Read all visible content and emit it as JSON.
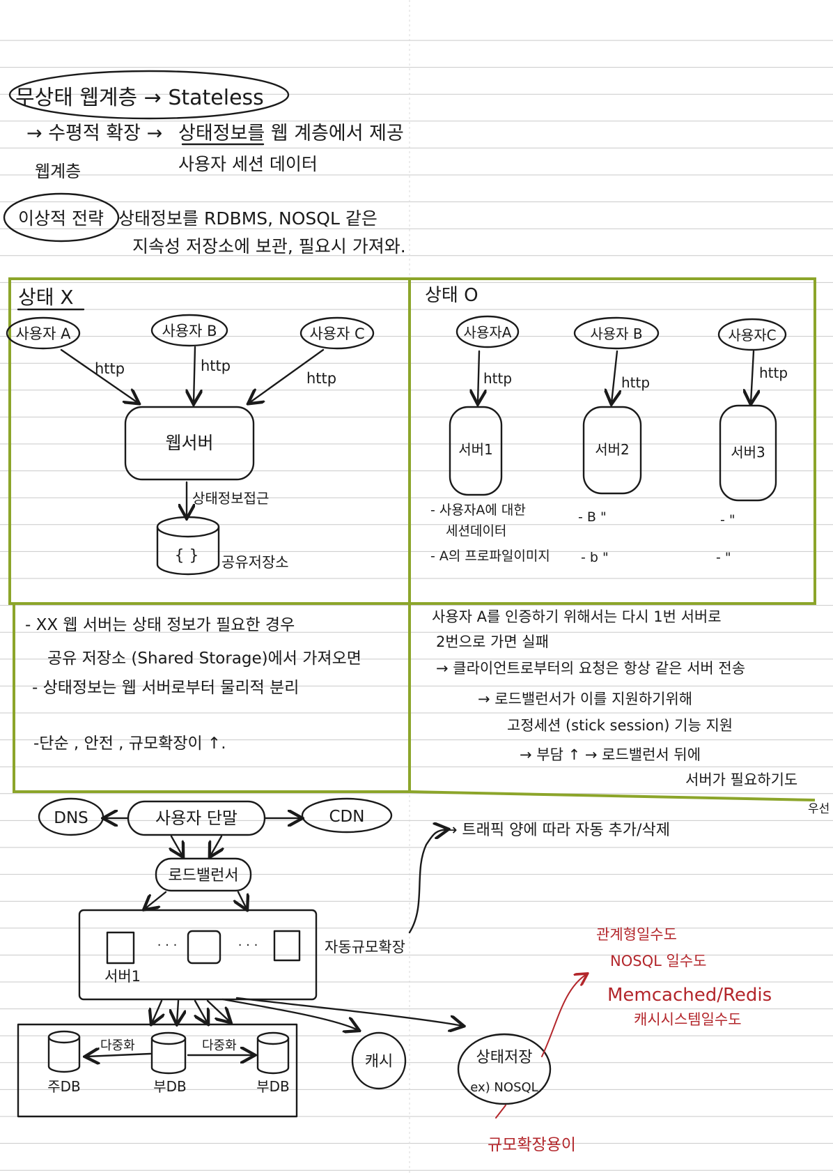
{
  "colors": {
    "ink": "#1a1a1a",
    "highlighter": "#8ca52a",
    "red_pen": "#b3262b",
    "ruled_line": "#c9c9c9"
  },
  "header": {
    "title": "무상태 웹계층 → Stateless",
    "line1_left": "→ 수평적 확장 →",
    "line1_right": "상태정보를 웹 계층에서 제공",
    "caret_label": "웹계층",
    "line2": "사용자 세션 데이터",
    "strategy_label": "이상적 전략",
    "strategy_line1": "상태정보를 RDBMS, NOSQL 같은",
    "strategy_line2": "지속성 저장소에 보관, 필요시 가져와."
  },
  "stateless_box": {
    "title": "상태 X",
    "users": [
      "사용자 A",
      "사용자 B",
      "사용자 C"
    ],
    "http": "http",
    "server": "웹서버",
    "access_label": "상태정보접근",
    "db_symbol": "{ }",
    "storage_label": "공유저장소"
  },
  "stateful_box": {
    "title": "상태 O",
    "users": [
      "사용자A",
      "사용자 B",
      "사용자C"
    ],
    "http": "http",
    "servers": [
      "서버1",
      "서버2",
      "서버3"
    ],
    "note1a": "- 사용자A에 대한",
    "note1b": "세션데이터",
    "note2": "- A의 프로파일이미지",
    "ditto1": [
      "- B \"",
      "- \""
    ],
    "ditto2": [
      "- b \"",
      "- \""
    ]
  },
  "stateless_notes": {
    "line1": "- XX 웹 서버는 상태 정보가 필요한 경우",
    "line2": "공유 저장소 (Shared Storage)에서 가져오면",
    "line3": "- 상태정보는 웹 서버로부터 물리적 분리",
    "line4": "-단순 , 안전 , 규모확장이 ↑."
  },
  "stateful_notes": {
    "line1": "사용자 A를 인증하기 위해서는 다시 1번 서버로",
    "line2": "2번으로 가면 실패",
    "line3": "→ 클라이언트로부터의 요청은 항상 같은 서버 전송",
    "line4": "→ 로드밸런서가 이를 지원하기위해",
    "line5": "고정세션 (stick session) 기능 지원",
    "line6": "→ 부담 ↑ → 로드밸런서 뒤에",
    "line7": "서버가 필요하기도"
  },
  "architecture": {
    "dns": "DNS",
    "client": "사용자 단말",
    "cdn": "CDN",
    "load_balancer": "로드밸런서",
    "server_dots": "· · ·",
    "server_label": "서버1",
    "autoscale_label": "자동규모확장",
    "traffic_note": "→ 트래픽 양에 따라 자동 추가/삭제",
    "master_db": "주DB",
    "replica_db_1": "부DB",
    "replica_db_2": "부DB",
    "replication": "다중화",
    "cache": "캐시",
    "state_store_1": "상태저장",
    "state_store_2": "ex) NOSQL",
    "side_mark": "우선"
  },
  "red_notes": {
    "line1": "관계형일수도",
    "line2": "NOSQL 일수도",
    "line3": "Memcached/Redis",
    "line4": "캐시시스템일수도",
    "bottom": "규모확장용이"
  }
}
